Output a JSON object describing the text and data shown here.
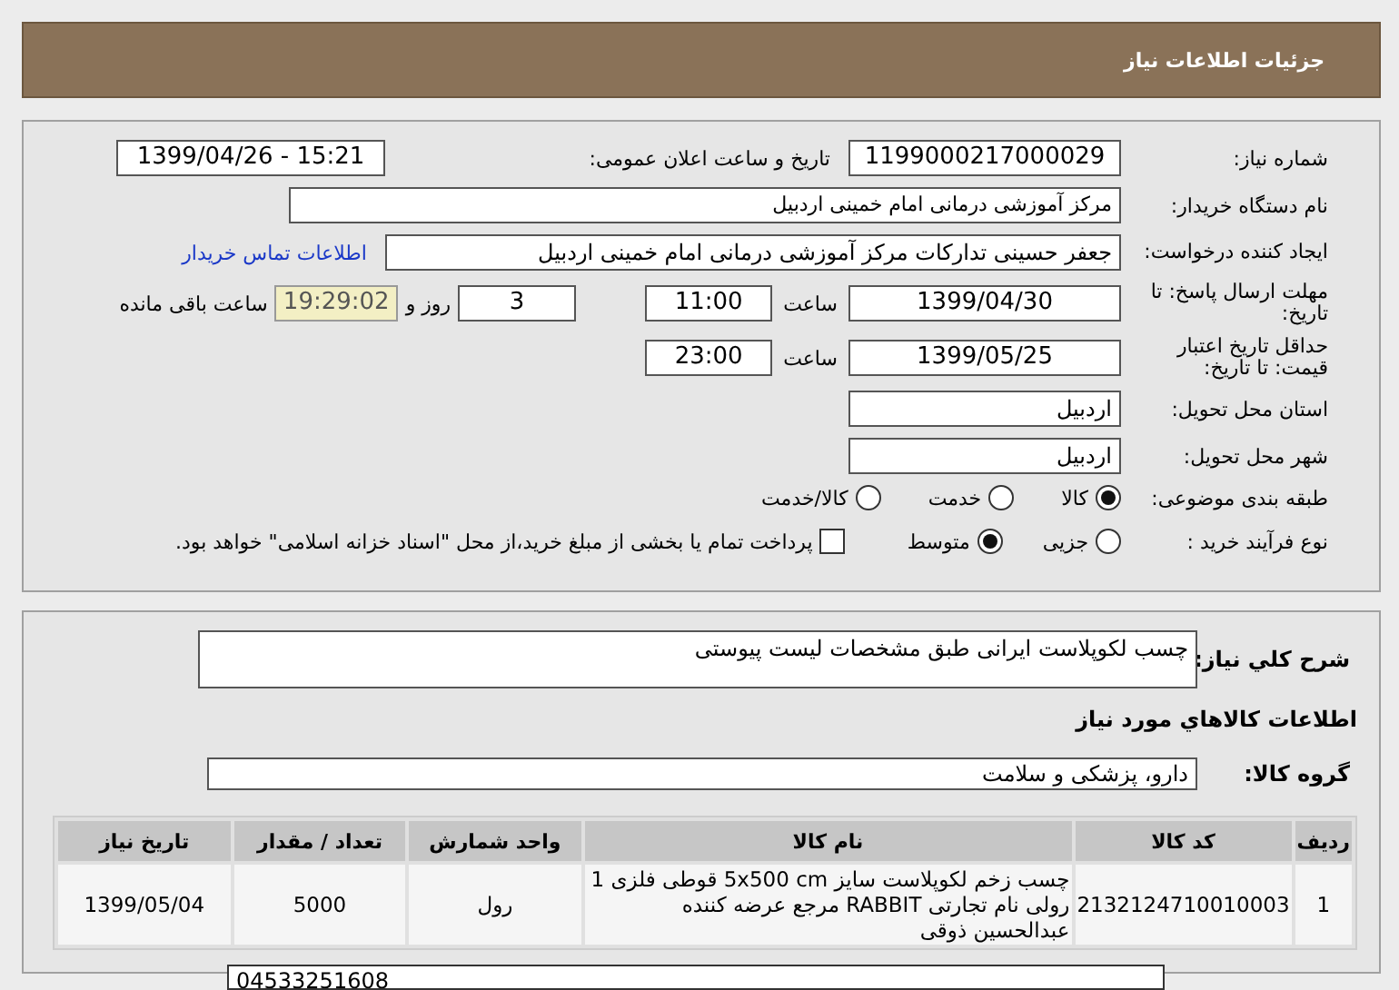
{
  "header": {
    "title": "جزئیات اطلاعات نیاز"
  },
  "details": {
    "need_number": {
      "label": "شماره نیاز:",
      "value": "1199000217000029"
    },
    "announce": {
      "label": "تاریخ و ساعت اعلان عمومی:",
      "value": "1399/04/26 - 15:21"
    },
    "buyer": {
      "label": "نام دستگاه خریدار:",
      "value": "مرکز آموزشی درمانی امام خمینی اردبیل"
    },
    "creator": {
      "label": "ایجاد کننده درخواست:",
      "value": "جعفر حسینی تدارکات  مرکز آموزشی درمانی امام خمینی اردبیل",
      "link": "اطلاعات تماس خریدار"
    },
    "deadline": {
      "label": "مهلت ارسال پاسخ: تا تاریخ:",
      "date": "1399/04/30",
      "time_label": "ساعت",
      "time": "11:00",
      "days": "3",
      "days_label": "روز و",
      "remaining": "19:29:02",
      "remaining_label": "ساعت باقی مانده"
    },
    "validity": {
      "label": "حداقل تاریخ اعتبار قیمت: تا تاریخ:",
      "date": "1399/05/25",
      "time_label": "ساعت",
      "time": "23:00"
    },
    "province": {
      "label": "استان محل تحویل:",
      "value": "اردبیل"
    },
    "city": {
      "label": "شهر محل تحویل:",
      "value": "اردبیل"
    },
    "classification": {
      "label": "طبقه بندی موضوعی:",
      "options": [
        {
          "label": "کالا",
          "selected": true
        },
        {
          "label": "خدمت",
          "selected": false
        },
        {
          "label": "کالا/خدمت",
          "selected": false
        }
      ]
    },
    "process": {
      "label": "نوع فرآیند خرید :",
      "options": [
        {
          "label": "جزیی",
          "selected": false
        },
        {
          "label": "متوسط",
          "selected": true
        }
      ],
      "treasury": {
        "label": "پرداخت تمام یا بخشی از مبلغ خرید،از محل \"اسناد خزانه اسلامی\" خواهد بود.",
        "checked": false
      }
    }
  },
  "need": {
    "description_label": "شرح كلي نياز:",
    "description": "چسب لکوپلاست ایرانی طبق مشخصات لیست پیوستی",
    "goods_title": "اطلاعات کالاهاي مورد نياز",
    "group_label": "گروه کالا:",
    "group": "دارو، پزشکی و سلامت",
    "table": {
      "columns": [
        "ردیف",
        "کد کالا",
        "نام کالا",
        "واحد شمارش",
        "تعداد / مقدار",
        "تاریخ نیاز"
      ],
      "rows": [
        [
          "1",
          "2132124710010003",
          "چسب زخم لکوپلاست سایز 5x500 cm قوطی فلزی 1 رولی نام تجارتی RABBIT مرجع عرضه کننده عبدالحسین ذوقی",
          "رول",
          "5000",
          "1399/05/04"
        ]
      ]
    },
    "note": "04533251608"
  }
}
